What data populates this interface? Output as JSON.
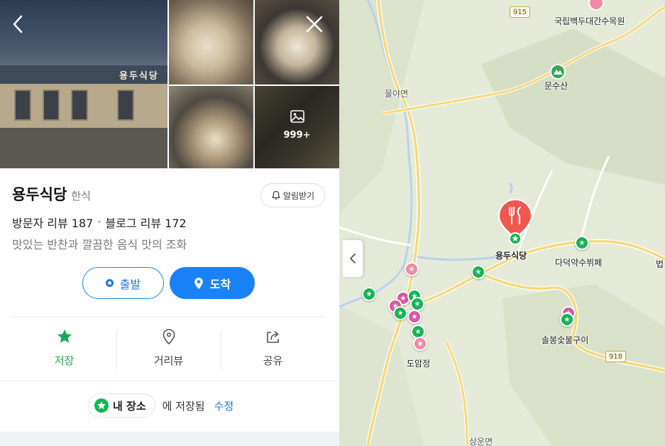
{
  "place": {
    "name": "용두식당",
    "category": "한식",
    "visitor_reviews": "방문자 리뷰 187",
    "blog_reviews": "블로그 리뷰 172",
    "description": "맛있는 반찬과 깔끔한 음식 맛의 조화",
    "photo_count": "999+",
    "sign_text": "용두식당"
  },
  "buttons": {
    "notify": "알림받기",
    "start": "출발",
    "arrive": "도착"
  },
  "actions": {
    "save": "저장",
    "streetview": "거리뷰",
    "share": "공유"
  },
  "saved": {
    "chip": "내 장소",
    "text": "에 저장됨",
    "edit": "수정"
  },
  "map": {
    "labels": {
      "arboretum": "국립백두대간수목원",
      "munsusan": "문수산",
      "mulyameon": "물야면",
      "marker": "용두식당",
      "dadeok": "다덕약수뷔페",
      "solbong": "솔봉숯불구이",
      "doamjeong": "도암정",
      "sangunmyeon": "상운면",
      "edge_label": "법"
    },
    "roads": {
      "r915": "915",
      "r918": "918"
    }
  },
  "colors": {
    "primary": "#1a82f7",
    "save_green": "#1aaa55",
    "marker_red": "#f0574e",
    "pin_green": "#15b553"
  }
}
